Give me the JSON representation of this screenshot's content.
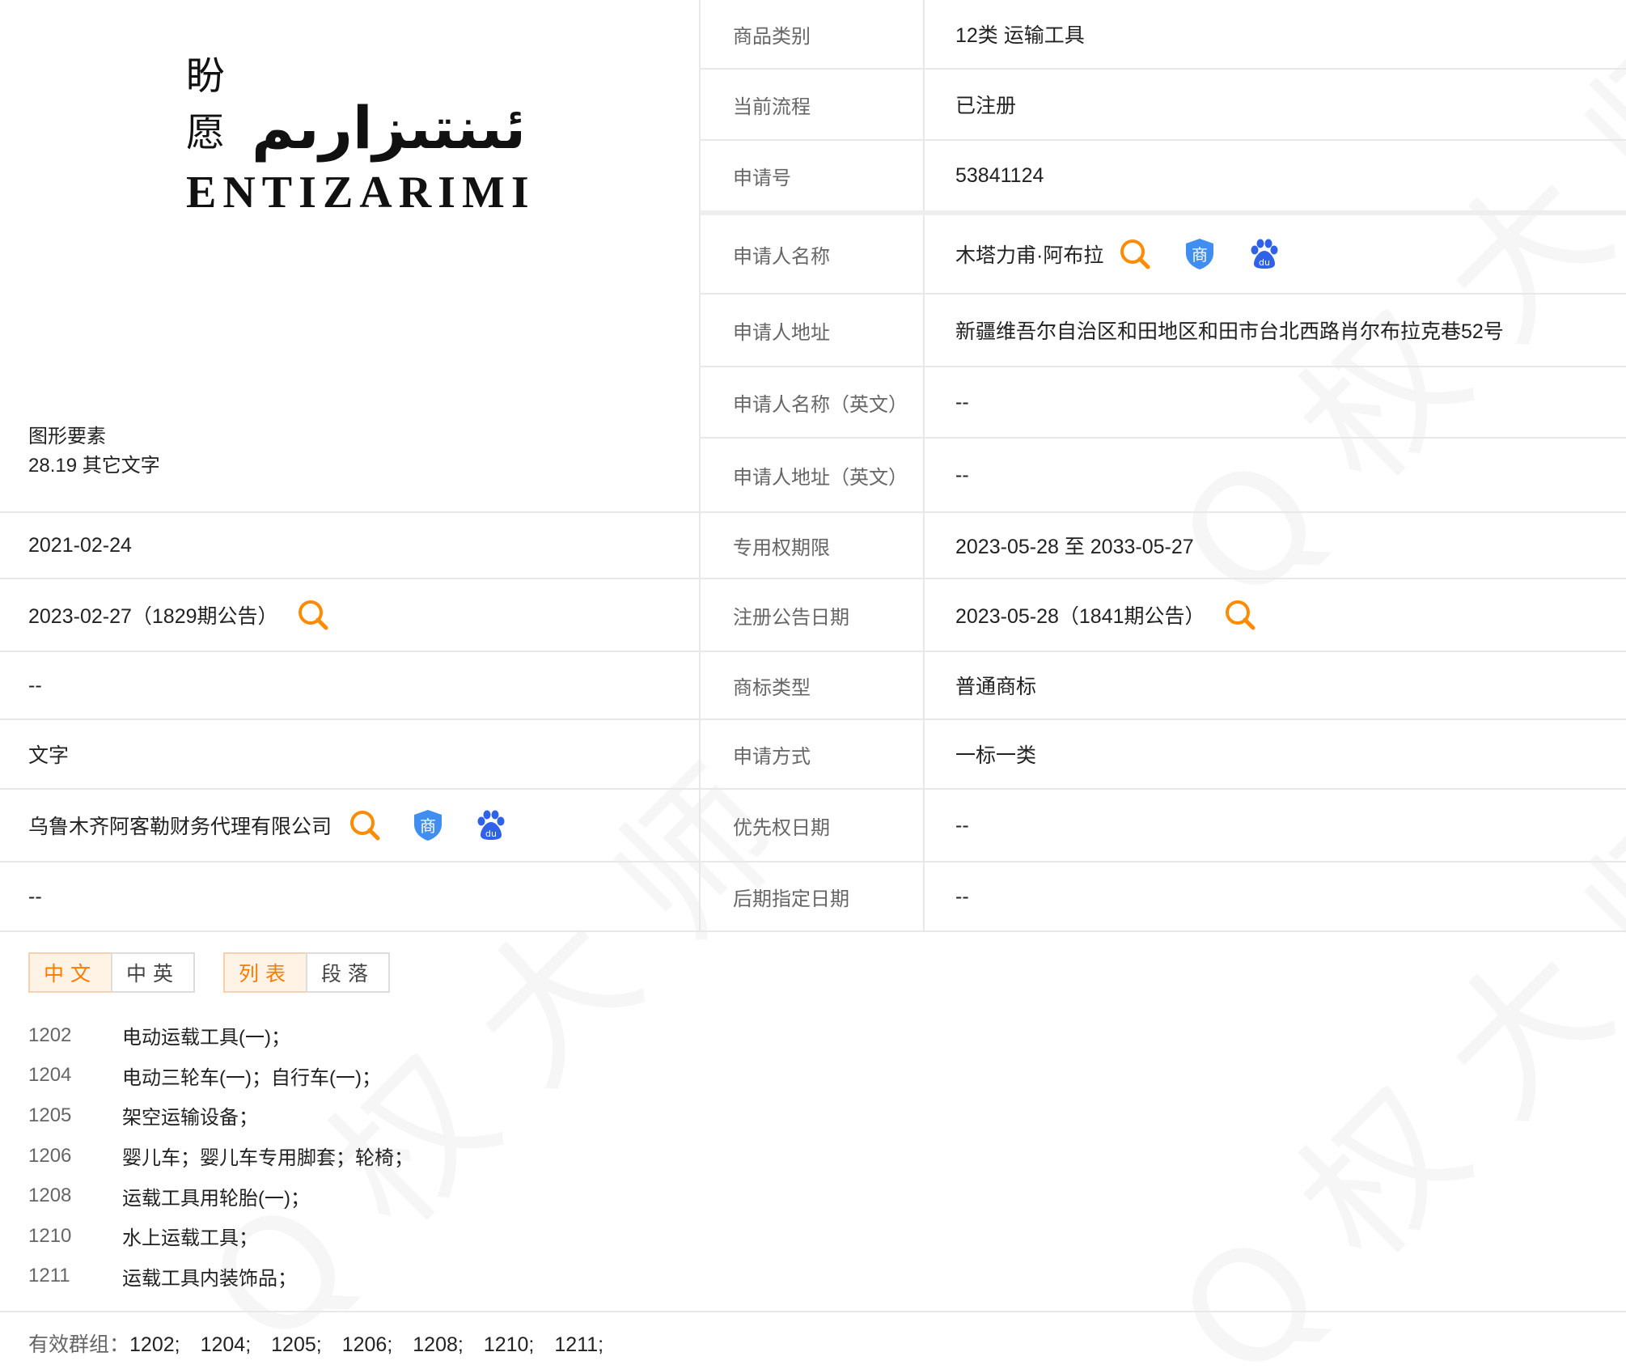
{
  "logo": {
    "chinese": "盼愿",
    "arabic": "ئىنتىزارىم",
    "latin": "ENTIZARIMI"
  },
  "figure_elements": {
    "label": "图形要素",
    "value": "28.19 其它文字"
  },
  "left_values": {
    "apply_date": "2021-02-24",
    "initial_announce": "2023-02-27（1829期公告）",
    "row3": "--",
    "composition": "文字",
    "agency": "乌鲁木齐阿客勒财务代理有限公司",
    "row6": "--"
  },
  "info": {
    "class": {
      "label": "商品类别",
      "value": "12类 运输工具"
    },
    "status": {
      "label": "当前流程",
      "value": "已注册"
    },
    "reg_no": {
      "label": "申请号",
      "value": "53841124"
    },
    "applicant": {
      "label": "申请人名称",
      "value": "木塔力甫·阿布拉"
    },
    "address": {
      "label": "申请人地址",
      "value": "新疆维吾尔自治区和田地区和田市台北西路肖尔布拉克巷52号"
    },
    "applicant_en": {
      "label": "申请人名称（英文）",
      "value": "--"
    },
    "address_en": {
      "label": "申请人地址（英文）",
      "value": "--"
    },
    "exclusive_period": {
      "label": "专用权期限",
      "value": "2023-05-28 至 2033-05-27"
    },
    "reg_announce": {
      "label": "注册公告日期",
      "value": "2023-05-28（1841期公告）"
    },
    "mark_type": {
      "label": "商标类型",
      "value": "普通商标"
    },
    "apply_method": {
      "label": "申请方式",
      "value": "一标一类"
    },
    "priority_date": {
      "label": "优先权日期",
      "value": "--"
    },
    "later_designation": {
      "label": "后期指定日期",
      "value": "--"
    }
  },
  "icons": {
    "search": "search-icon",
    "shang": "trademark-shield-icon",
    "baidu": "baidu-paw-icon",
    "shang_char": "商",
    "baidu_text": "du"
  },
  "tabs": {
    "lang": [
      "中文",
      "中英"
    ],
    "view": [
      "列表",
      "段落"
    ]
  },
  "goods": [
    {
      "code": "1202",
      "name": "电动运载工具(一)；"
    },
    {
      "code": "1204",
      "name": "电动三轮车(一)；自行车(一)；"
    },
    {
      "code": "1205",
      "name": "架空运输设备；"
    },
    {
      "code": "1206",
      "name": "婴儿车；婴儿车专用脚套；轮椅；"
    },
    {
      "code": "1208",
      "name": "运载工具用轮胎(一)；"
    },
    {
      "code": "1210",
      "name": "水上运载工具；"
    },
    {
      "code": "1211",
      "name": "运载工具内装饰品；"
    }
  ],
  "footer": {
    "label": "有效群组：",
    "groups": "1202;　1204;　1205;　1206;　1208;　1210;　1211;"
  },
  "colors": {
    "accent": "#ff7a00",
    "shield_blue": "#3f8ef0",
    "baidu_blue": "#2f62e8",
    "border": "#e8e8e8"
  }
}
